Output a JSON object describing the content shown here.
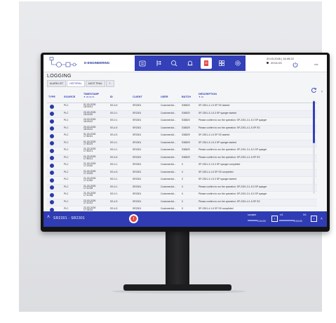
{
  "header": {
    "project_label": "D-ENGINEERING",
    "datetime_line1": "20.03.2026 | 16:45:22",
    "datetime_line2": "20:01:03",
    "user_label": "rdv"
  },
  "nav_icons": [
    "recipe-icon",
    "process-icon",
    "analytics-icon",
    "alarm-icon",
    "logging-icon",
    "grid-icon",
    "settings-icon"
  ],
  "page_title": "LOGGING",
  "tabs": [
    {
      "label": "ALARM LIST",
      "active": false
    },
    {
      "label": "HISTORIAL",
      "active": true
    },
    {
      "label": "AUDIT TRAIL",
      "active": false
    },
    {
      "label": "+",
      "active": false
    }
  ],
  "table": {
    "headers": {
      "type": "TYPE",
      "source": "SOURCE",
      "timestamp": "TIMESTAMP",
      "timestamp_filter": "20:01:01",
      "id": "ID",
      "client": "CLIENT",
      "user": "USER",
      "batch": "BATCH",
      "description": "DESCRIPTION",
      "description_filter": "All"
    },
    "rows": [
      {
        "source": "PLC",
        "ts1": "01-03-2026",
        "ts2": "18:03:31",
        "id": "SS-4.5",
        "client": "SR2301",
        "user": "CustomerAd...",
        "batch": "S38820",
        "desc": "SP-2301-4.1-5 SP SS started"
      },
      {
        "source": "PLC",
        "ts1": "20-03-2026",
        "ts2": "18:03:30",
        "id": "SS-0.1",
        "client": "SR2301",
        "user": "CustomerAd...",
        "batch": "S38820",
        "desc": "SP-2301-3.1-5.3 SP sparger started"
      },
      {
        "source": "PLC",
        "ts1": "20-03-2026",
        "ts2": "18:03:22",
        "id": "SS-0.1",
        "client": "SR2301",
        "user": "CustomerAd...",
        "batch": "S38820",
        "desc": "Please confirm to run the operation: SP-2301-3.1-5.3 SP sparger"
      },
      {
        "source": "PLC",
        "ts1": "20-03-2026",
        "ts2": "18:03:22",
        "id": "SS-4.5",
        "client": "SR2301",
        "user": "CustomerAd...",
        "batch": "S38829",
        "desc": "Please confirm to run the operation: SP-2301-4.1-5 SP SS"
      },
      {
        "source": "PLC",
        "ts1": "01-03-2026",
        "ts2": "17:50:31",
        "id": "SS-4.5",
        "client": "SR2301",
        "user": "CustomerAd...",
        "batch": "S38829",
        "desc": "SP-2301-4.1-5 SP SS started"
      },
      {
        "source": "PLC",
        "ts1": "01-03-2026",
        "ts2": "17:50:29",
        "id": "SS-0.1",
        "client": "SR2301",
        "user": "CustomerAd...",
        "batch": "S38829",
        "desc": "SP-2301-3.1-5.3 SP sparger started"
      },
      {
        "source": "PLC",
        "ts1": "21-03-2026",
        "ts2": "17:50:21",
        "id": "SS-0.1",
        "client": "SR2301",
        "user": "CustomerAd...",
        "batch": "S38829",
        "desc": "Please confirm to run the operation: SP-2301-3.1-5.3 SP sparger"
      },
      {
        "source": "PLC",
        "ts1": "21-03-2026",
        "ts2": "17:50:21",
        "id": "SS-4.5",
        "client": "SR2301",
        "user": "CustomerAd...",
        "batch": "S38829",
        "desc": "Please confirm to run the operation: SP-2301-4.1-5 SP SS"
      },
      {
        "source": "PLC",
        "ts1": "21-03-2026",
        "ts2": "17:23:40",
        "id": "SS-0.1",
        "client": "SR2301",
        "user": "CustomerAd...",
        "batch": "0",
        "desc": "SP-2301-3.1-5.3 SP sparger completed"
      },
      {
        "source": "PLC",
        "ts1": "21-03-2026",
        "ts2": "17:23:39",
        "id": "SS-4.5",
        "client": "SR2301",
        "user": "CustomerAd...",
        "batch": "0",
        "desc": "SP-2301-4.1-5 SP SS completed"
      },
      {
        "source": "PLC",
        "ts1": "21-03-2026",
        "ts2": "17:10:50",
        "id": "SS-0.1",
        "client": "SR2301",
        "user": "CustomerAd...",
        "batch": "0",
        "desc": "SP-2301-3.1-5.3 SP sparger started"
      },
      {
        "source": "PLC",
        "ts1": "21-03-2026",
        "ts2": "17:10:38",
        "id": "SS-0.1",
        "client": "SR2301",
        "user": "CustomerAd...",
        "batch": "0",
        "desc": "Please confirm to run the operation: SP-2301-3.1-5.3 SP sparger"
      },
      {
        "source": "PLC",
        "ts1": "21-03-2026",
        "ts2": "17:10:38",
        "id": "SS-0.1",
        "client": "SR2301",
        "user": "CustomerAd...",
        "batch": "0",
        "desc": "Please confirm to run the operation: SP-2301-3.1-5.3 SP sparger"
      },
      {
        "source": "PLC",
        "ts1": "22-03-2026",
        "ts2": "17:10:22",
        "id": "SS-4.5",
        "client": "SR2301",
        "user": "CustomerAd...",
        "batch": "0",
        "desc": "Please confirm to run the operation: SP-2301-4.1-5 SP SS"
      },
      {
        "source": "PLC",
        "ts1": "22-03-2026",
        "ts2": "17:05:26",
        "id": "SS-4.5",
        "client": "SR2301",
        "user": "CustomerAd...",
        "batch": "0",
        "desc": "SP-2301-4.1-5 SP SS completed"
      }
    ]
  },
  "bottombar": {
    "label": "SR2301 - SR2301",
    "alarm_count": "!",
    "section1_title": "sampler",
    "section1_value": "0:04:00",
    "section2_title": "x/1",
    "section2_value": "0:04:00",
    "section2_page": "0/1"
  },
  "colors": {
    "accent": "#3340b8",
    "alarm": "#e54848"
  }
}
